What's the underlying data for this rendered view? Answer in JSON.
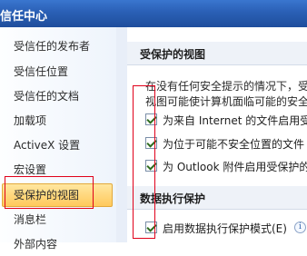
{
  "window": {
    "title": "信任中心"
  },
  "sidebar": {
    "items": [
      {
        "label": "受信任的发布者"
      },
      {
        "label": "受信任位置"
      },
      {
        "label": "受信任的文档"
      },
      {
        "label": "加载项"
      },
      {
        "label": "ActiveX 设置"
      },
      {
        "label": "宏设置"
      },
      {
        "label": "受保护的视图",
        "selected": true
      },
      {
        "label": "消息栏"
      },
      {
        "label": "外部内容"
      }
    ]
  },
  "protected_view": {
    "heading": "受保护的视图",
    "description_line1": "在没有任何安全提示的情况下，受",
    "description_line2": "视图可能使计算机面临可能的安全",
    "options": [
      {
        "label": "为来自 Internet 的文件启用受",
        "checked": true
      },
      {
        "label": "为位于可能不安全位置的文件",
        "checked": true
      },
      {
        "label": "为 Outlook 附件启用受保护的",
        "checked": true
      }
    ]
  },
  "dep": {
    "heading": "数据执行保护",
    "option_label": "启用数据执行保护模式(E)",
    "checked": true
  },
  "icons": {
    "info": "info-icon"
  }
}
